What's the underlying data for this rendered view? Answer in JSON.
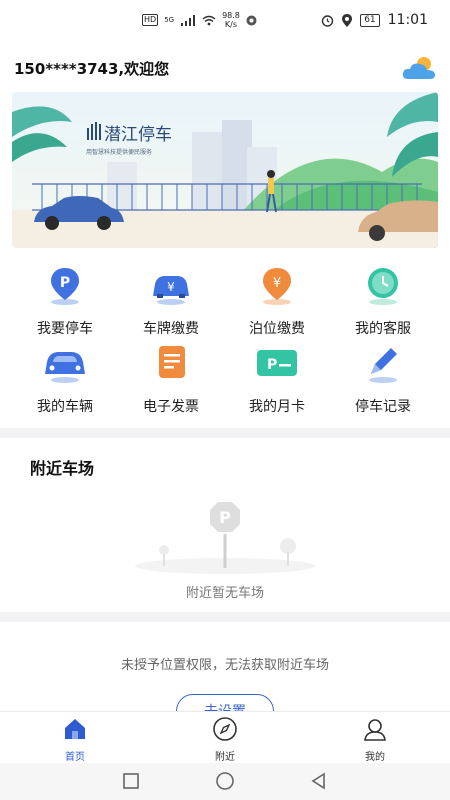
{
  "status_bar": {
    "hd_badge": "HD",
    "network": "5G",
    "speed_value": "98.8",
    "speed_unit": "K/s",
    "battery": "61",
    "time": "11:01"
  },
  "header": {
    "greeting": "150****3743,欢迎您",
    "weather_icon": "cloud-sun-icon"
  },
  "banner": {
    "title": "潜江停车",
    "subtitle": "用智慧科技提供便民服务"
  },
  "services": [
    {
      "label": "我要停车",
      "icon": "parking-pin-icon",
      "color": "#3f72e0"
    },
    {
      "label": "车牌缴费",
      "icon": "car-yuan-icon",
      "color": "#3f72e0"
    },
    {
      "label": "泊位缴费",
      "icon": "yuan-pin-icon",
      "color": "#f08a3c"
    },
    {
      "label": "我的客服",
      "icon": "clock-icon",
      "color": "#33c4a4"
    },
    {
      "label": "我的车辆",
      "icon": "car-icon",
      "color": "#3f72e0"
    },
    {
      "label": "电子发票",
      "icon": "invoice-icon",
      "color": "#f08a3c"
    },
    {
      "label": "我的月卡",
      "icon": "parking-card-icon",
      "color": "#33c4a4"
    },
    {
      "label": "停车记录",
      "icon": "pencil-icon",
      "color": "#3f72e0"
    }
  ],
  "nearby": {
    "title": "附近车场",
    "empty_text": "附近暂无车场",
    "empty_icon": "parking-sign-icon"
  },
  "permission": {
    "message": "未授予位置权限，无法获取附近车场",
    "button_label": "去设置"
  },
  "tabbar": {
    "items": [
      {
        "label": "首页",
        "icon": "home-icon",
        "active": true
      },
      {
        "label": "附近",
        "icon": "compass-icon",
        "active": false
      },
      {
        "label": "我的",
        "icon": "user-icon",
        "active": false
      }
    ]
  },
  "colors": {
    "accent": "#2f5bd0",
    "page_bg": "#ffffff",
    "separator": "#f2f2f4"
  }
}
